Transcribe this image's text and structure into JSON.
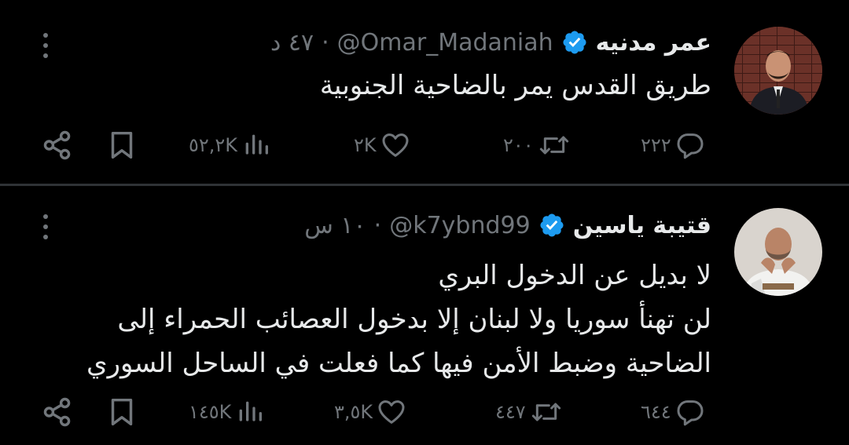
{
  "colors": {
    "background": "#000000",
    "text": "#e7e9ea",
    "secondary": "#71767b",
    "verified": "#1d9bf0",
    "divider": "#2f3336"
  },
  "tweets": [
    {
      "display_name": "عمر مدنيه",
      "handle": "@Omar_Madaniah",
      "separator": "·",
      "time": "٤٧ د",
      "lines": [
        "طريق القدس يمر بالضاحية الجنوبية"
      ],
      "replies": "٢٢٢",
      "retweets": "٢٠٠",
      "likes": "٢K",
      "views": "٥٢,٢K"
    },
    {
      "display_name": "قتيبة ياسين",
      "handle": "@k7ybnd99",
      "separator": "·",
      "time": "١٠ س",
      "lines": [
        "لا بديل عن الدخول البري",
        "لن تهنأ سوريا ولا لبنان إلا بدخول العصائب الحمراء إلى",
        "الضاحية وضبط الأمن فيها كما فعلت في الساحل السوري"
      ],
      "replies": "٦٤٤",
      "retweets": "٤٤٧",
      "likes": "٣,٥K",
      "views": "١٤٥K"
    }
  ]
}
